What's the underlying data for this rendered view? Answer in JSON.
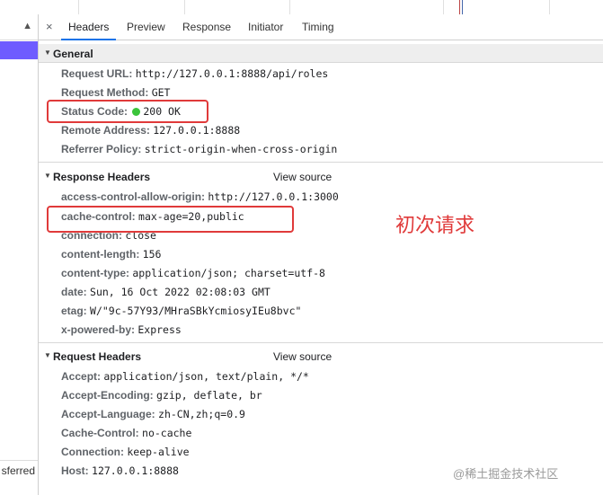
{
  "left_panel": {
    "arrow": "▲",
    "footer": "sferred"
  },
  "tabs": {
    "close": "×",
    "items": [
      "Headers",
      "Preview",
      "Response",
      "Initiator",
      "Timing"
    ]
  },
  "general": {
    "title": "General",
    "rows": [
      {
        "k": "Request URL:",
        "v": "http://127.0.0.1:8888/api/roles"
      },
      {
        "k": "Request Method:",
        "v": "GET"
      },
      {
        "k": "Status Code:",
        "v": "200 OK"
      },
      {
        "k": "Remote Address:",
        "v": "127.0.0.1:8888"
      },
      {
        "k": "Referrer Policy:",
        "v": "strict-origin-when-cross-origin"
      }
    ]
  },
  "response_headers": {
    "title": "Response Headers",
    "view_source": "View source",
    "rows": [
      {
        "k": "access-control-allow-origin:",
        "v": "http://127.0.0.1:3000"
      },
      {
        "k": "cache-control:",
        "v": "max-age=20,public"
      },
      {
        "k": "connection:",
        "v": "close"
      },
      {
        "k": "content-length:",
        "v": "156"
      },
      {
        "k": "content-type:",
        "v": "application/json; charset=utf-8"
      },
      {
        "k": "date:",
        "v": "Sun, 16 Oct 2022 02:08:03 GMT"
      },
      {
        "k": "etag:",
        "v": "W/\"9c-57Y93/MHraSBkYcmiosyIEu8bvc\""
      },
      {
        "k": "x-powered-by:",
        "v": "Express"
      }
    ]
  },
  "request_headers": {
    "title": "Request Headers",
    "view_source": "View source",
    "rows": [
      {
        "k": "Accept:",
        "v": "application/json, text/plain, */*"
      },
      {
        "k": "Accept-Encoding:",
        "v": "gzip, deflate, br"
      },
      {
        "k": "Accept-Language:",
        "v": "zh-CN,zh;q=0.9"
      },
      {
        "k": "Cache-Control:",
        "v": "no-cache"
      },
      {
        "k": "Connection:",
        "v": "keep-alive"
      },
      {
        "k": "Host:",
        "v": "127.0.0.1:8888"
      }
    ]
  },
  "annotation": "初次请求",
  "watermark": "@稀土掘金技术社区",
  "colors": {
    "highlight": "#e03a3a",
    "status_ok": "#3bc43b",
    "selected_row": "#6e5cff",
    "active_tab": "#1a73e8"
  }
}
